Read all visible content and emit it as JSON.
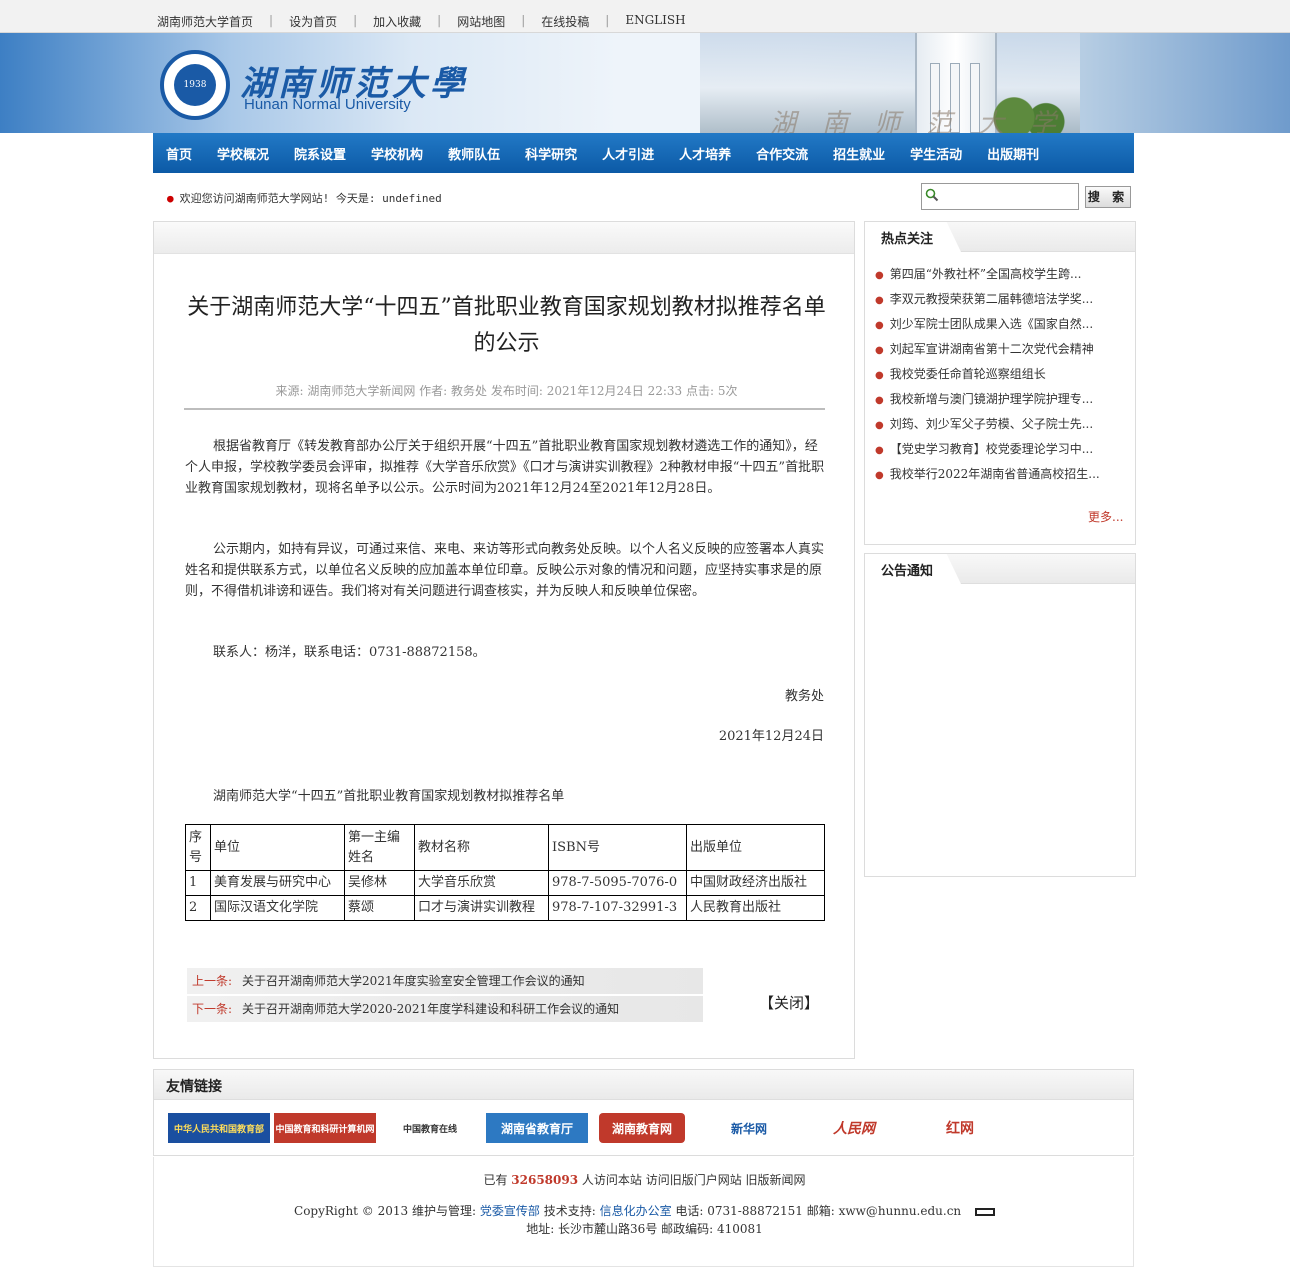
{
  "topbar": {
    "links": [
      "湖南师范大学首页",
      "设为首页",
      "加入收藏",
      "网站地图",
      "在线投稿",
      "ENGLISH"
    ]
  },
  "header": {
    "logo_cn": "湖南师范大學",
    "logo_en": "Hunan Normal University",
    "seal_year": "1938",
    "gate_text": "湖南师范大学"
  },
  "nav": [
    "首页",
    "学校概况",
    "院系设置",
    "学校机构",
    "教师队伍",
    "科学研究",
    "人才引进",
    "人才培养",
    "合作交流",
    "招生就业",
    "学生活动",
    "出版期刊"
  ],
  "welcome": "欢迎您访问湖南师范大学网站! 今天是: undefined",
  "search": {
    "button": "搜 索",
    "placeholder": ""
  },
  "article": {
    "title": "关于湖南师范大学“十四五”首批职业教育国家规划教材拟推荐名单的公示",
    "meta": "来源: 湖南师范大学新闻网 作者: 教务处 发布时间: 2021年12月24日 22:33 点击: 5次",
    "p1": "根据省教育厅《转发教育部办公厅关于组织开展“十四五”首批职业教育国家规划教材遴选工作的通知》，经个人申报，学校教学委员会评审，拟推荐《大学音乐欣赏》《口才与演讲实训教程》2种教材申报“十四五”首批职业教育国家规划教材，现将名单予以公示。公示时间为2021年12月24至2021年12月28日。",
    "p2": "公示期内，如持有异议，可通过来信、来电、来访等形式向教务处反映。以个人名义反映的应签署本人真实姓名和提供联系方式，以单位名义反映的应加盖本单位印章。反映公示对象的情况和问题，应坚持实事求是的原则，不得借机诽谤和诬告。我们将对有关问题进行调查核实，并为反映人和反映单位保密。",
    "contact": "联系人：杨洋，联系电话：0731-88872158。",
    "signer": "教务处",
    "date": "2021年12月24日",
    "table_title": "湖南师范大学“十四五”首批职业教育国家规划教材拟推荐名单",
    "table": {
      "headers": [
        "序号",
        "单位",
        "第一主编姓名",
        "教材名称",
        "ISBN号",
        "出版单位"
      ],
      "rows": [
        [
          "1",
          "美育发展与研究中心",
          "吴修林",
          "大学音乐欣赏",
          "978-7-5095-7076-0",
          "中国财政经济出版社"
        ],
        [
          "2",
          "国际汉语文化学院",
          "蔡颂",
          "口才与演讲实训教程",
          "978-7-107-32991-3",
          "人民教育出版社"
        ]
      ]
    },
    "prev_label": "上一条:",
    "prev_title": "关于召开湖南师范大学2021年度实验室安全管理工作会议的通知",
    "next_label": "下一条:",
    "next_title": "关于召开湖南师范大学2020-2021年度学科建设和科研工作会议的通知",
    "close": "【关闭】"
  },
  "sidebar": {
    "hot_title": "热点关注",
    "hot_items": [
      "第四届“外教社杯”全国高校学生跨...",
      "李双元教授荣获第二届韩德培法学奖...",
      "刘少军院士团队成果入选《国家自然...",
      "刘起军宣讲湖南省第十二次党代会精神",
      "我校党委任命首轮巡察组组长",
      "我校新增与澳门镜湖护理学院护理专...",
      "刘筠、刘少军父子劳模、父子院士先...",
      "【党史学习教育】校党委理论学习中...",
      "我校举行2022年湖南省普通高校招生..."
    ],
    "more": "更多...",
    "notice_title": "公告通知"
  },
  "friend_links": {
    "title": "友情链接",
    "items": [
      {
        "label": "中华人民共和国教育部",
        "color": "#c0392b"
      },
      {
        "label": "中国教育和科研计算机网",
        "color": "#c0392b"
      },
      {
        "label": "中国教育在线",
        "color": "#333333"
      },
      {
        "label": "湖南省教育厅",
        "color": "#1a5aa6"
      },
      {
        "label": "湖南教育网",
        "color": "#c0392b"
      },
      {
        "label": "新华网",
        "color": "#1a5aa6"
      },
      {
        "label": "人民网",
        "color": "#c0392b"
      },
      {
        "label": "红网",
        "color": "#c0392b"
      }
    ]
  },
  "footer": {
    "visit_prefix": "已有",
    "visit_count": "32658093",
    "visit_suffix": "人访问本站  访问旧版门户网站  旧版新闻网",
    "copyright": "CopyRight © 2013   维护与管理:",
    "maintainer": "党委宣传部",
    "tech_label": "技术支持:",
    "tech": "信息化办公室",
    "contact": "电话: 0731-88872151  邮箱: xww@hunnu.edu.cn",
    "address": "地址: 长沙市麓山路36号  邮政编码: 410081"
  }
}
